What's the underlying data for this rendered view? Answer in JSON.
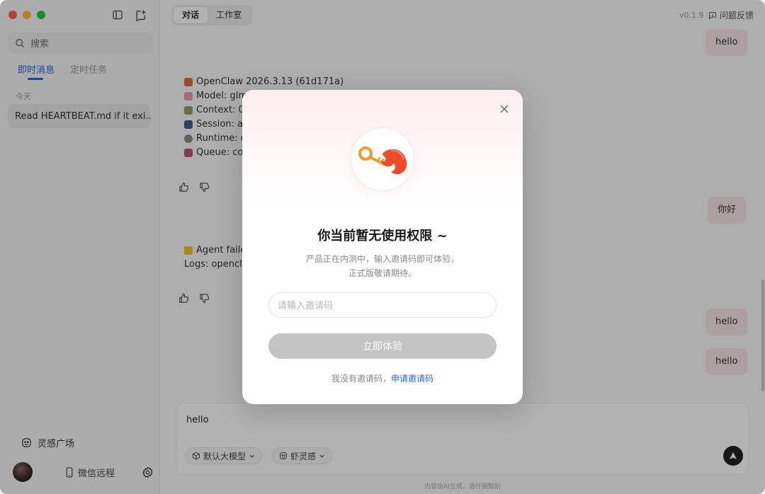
{
  "sidebar": {
    "search_placeholder": "搜索",
    "tabs": [
      {
        "label": "即时消息",
        "active": true
      },
      {
        "label": "定时任务",
        "active": false
      }
    ],
    "day_label": "今天",
    "conversation": "Read HEARTBEAT.md if it exi...",
    "inspire_label": "灵感广场",
    "wechat_label": "微信远程"
  },
  "header": {
    "tabs": [
      {
        "label": "对话",
        "active": true
      },
      {
        "label": "工作室",
        "active": false
      }
    ],
    "version": "v0.1.9",
    "feedback_label": "问题反馈"
  },
  "chat": {
    "user_messages": [
      "hello",
      "你好",
      "hello",
      "hello"
    ],
    "bot_status_lines": [
      "OpenClaw 2026.3.13 (61d171a)",
      "Model: glm/",
      "Context: 0/",
      "Session: ag",
      "Runtime: di",
      "Queue: coll"
    ],
    "warn_lines": [
      "Agent failed",
      "Logs: opencla"
    ]
  },
  "composer": {
    "text": "hello",
    "model_chip": "默认大模型",
    "inspire_chip": "虾灵感"
  },
  "footer_note": "内容由AI生成，请仔细甄别",
  "modal": {
    "title": "你当前暂无使用权限 ~",
    "desc_line1": "产品正在内测中，输入邀请码即可体验，",
    "desc_line2": "正式版敬请期待。",
    "input_placeholder": "请输入邀请码",
    "submit_label": "立即体验",
    "no_code_text": "我没有邀请码，",
    "apply_link": "申请邀请码"
  },
  "colors": {
    "accent": "#2b62d9",
    "user_bubble": "#f6e6e6",
    "disabled_button": "#c4c4c4"
  }
}
